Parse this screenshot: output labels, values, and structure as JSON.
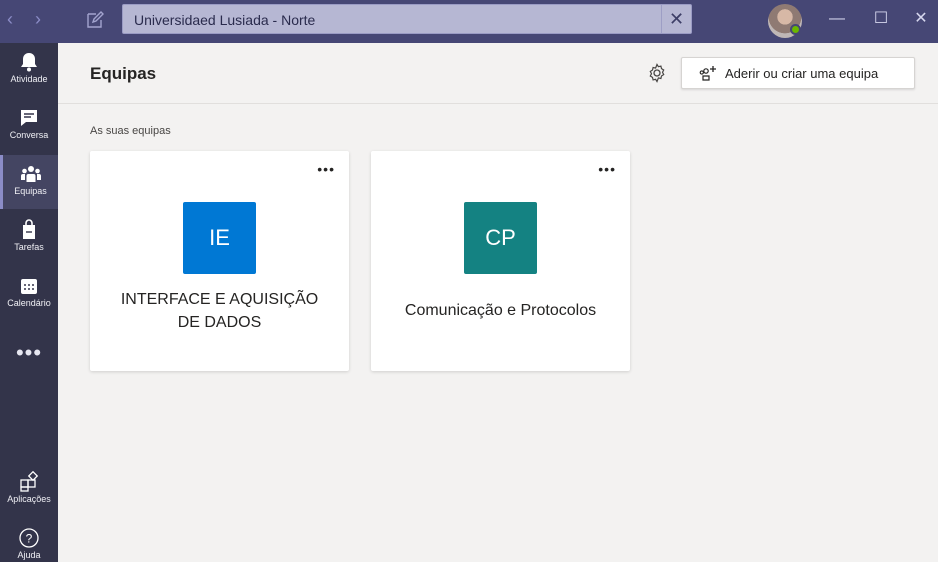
{
  "search": {
    "value": "Universidaed Lusiada - Norte"
  },
  "rail": {
    "items": [
      {
        "label": "Atividade",
        "icon": "bell-icon"
      },
      {
        "label": "Conversa",
        "icon": "chat-icon"
      },
      {
        "label": "Equipas",
        "icon": "teams-icon"
      },
      {
        "label": "Tarefas",
        "icon": "tasks-icon"
      },
      {
        "label": "Calendário",
        "icon": "calendar-icon"
      }
    ],
    "more": "•••",
    "apps_label": "Aplicações",
    "help_label": "Ajuda"
  },
  "header": {
    "title": "Equipas",
    "join_label": "Aderir ou criar uma equipa"
  },
  "section_label": "As suas equipas",
  "teams": [
    {
      "initials": "IE",
      "name_line1": "INTERFACE E AQUISIÇÃO",
      "name_line2": "DE DADOS",
      "color": "#0078d4"
    },
    {
      "initials": "CP",
      "name_line1": "Comunicação e Protocolos",
      "name_line2": "",
      "color": "#148282"
    }
  ],
  "colors": {
    "titlebar": "#464775",
    "rail": "#33344a",
    "accent": "#8b8cc7"
  }
}
